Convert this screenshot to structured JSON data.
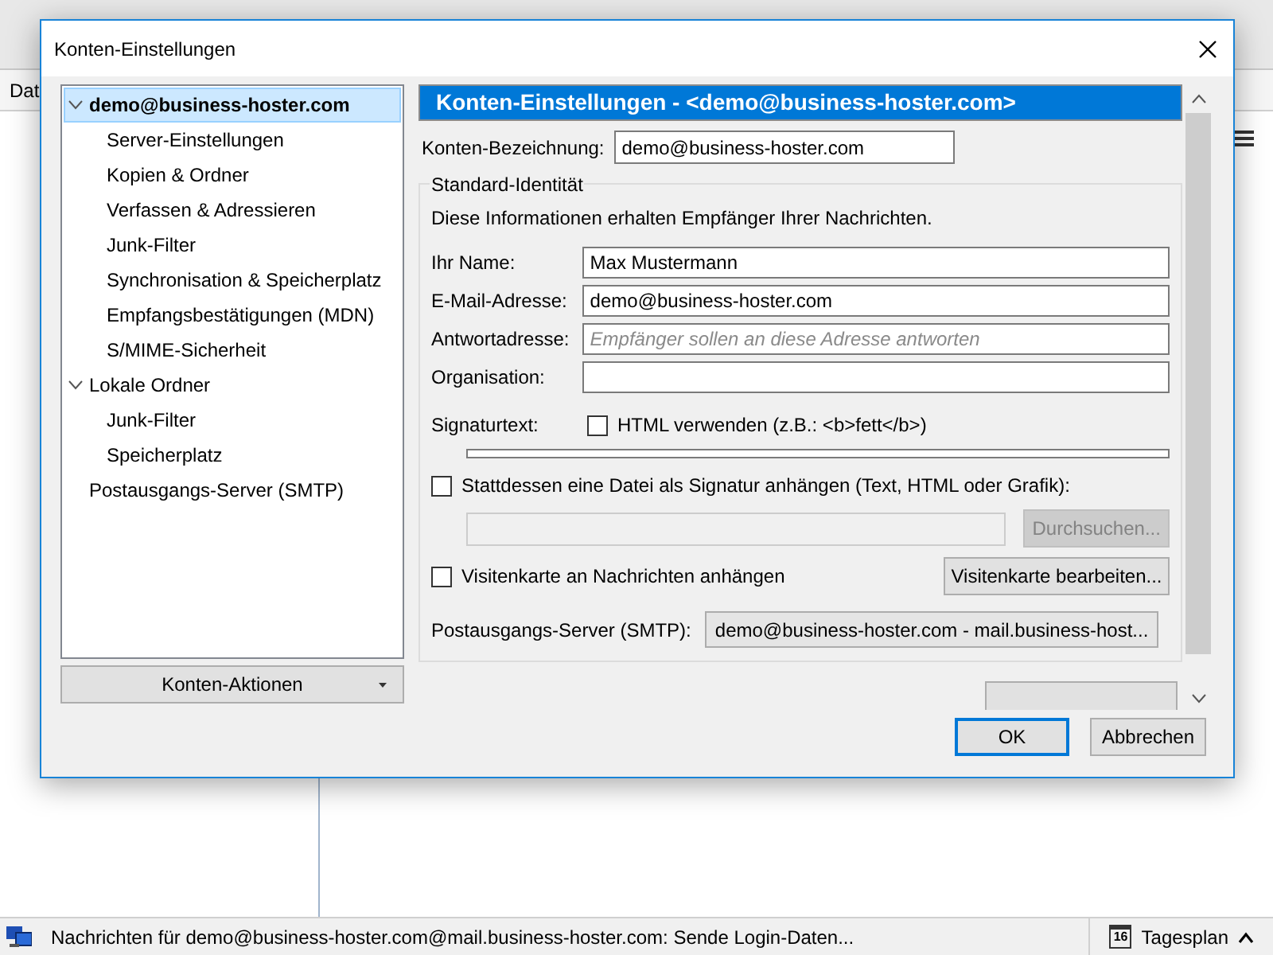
{
  "background_window": {
    "menu_label": "Dat",
    "status_bar": {
      "text": "Nachrichten für demo@business-hoster.com@mail.business-hoster.com: Sende Login-Daten...",
      "calendar_day": "16",
      "calendar_label": "Tagesplan"
    }
  },
  "dialog": {
    "title": "Konten-Einstellungen",
    "tree": [
      {
        "label": "demo@business-hoster.com",
        "bold": true,
        "expanded": true,
        "selected": true,
        "children": [
          {
            "label": "Server-Einstellungen",
            "selected": false
          },
          {
            "label": "Kopien & Ordner",
            "selected": false
          },
          {
            "label": "Verfassen & Adressieren",
            "selected": false
          },
          {
            "label": "Junk-Filter",
            "selected": false
          },
          {
            "label": "Synchronisation & Speicherplatz",
            "selected": false
          },
          {
            "label": "Empfangsbestätigungen (MDN)",
            "selected": false
          },
          {
            "label": "S/MIME-Sicherheit",
            "selected": false
          }
        ]
      },
      {
        "label": "Lokale Ordner",
        "bold": false,
        "expanded": true,
        "selected": false,
        "children": [
          {
            "label": "Junk-Filter",
            "selected": false
          },
          {
            "label": "Speicherplatz",
            "selected": false
          }
        ]
      },
      {
        "label": "Postausgangs-Server (SMTP)",
        "bold": false,
        "selected": false
      }
    ],
    "actions_button": "Konten-Aktionen",
    "header": "Konten-Einstellungen - <demo@business-hoster.com>",
    "account_name": {
      "label": "Konten-Bezeichnung:",
      "value": "demo@business-hoster.com"
    },
    "identity": {
      "legend": "Standard-Identität",
      "description": "Diese Informationen erhalten Empfänger Ihrer Nachrichten.",
      "fields": [
        {
          "label": "Ihr Name:",
          "value": "Max Mustermann"
        },
        {
          "label": "E-Mail-Adresse:",
          "value": "demo@business-hoster.com"
        },
        {
          "label": "Antwortadresse:",
          "placeholder": "Empfänger sollen an diese Adresse antworten"
        },
        {
          "label": "Organisation:"
        }
      ],
      "signature_label": "Signaturtext:",
      "html_checkbox": {
        "label": "HTML verwenden (z.B.: <b>fett</b>)",
        "checked": false
      },
      "file_checkbox": {
        "label": "Stattdessen eine Datei als Signatur anhängen (Text, HTML oder Grafik):",
        "checked": false
      },
      "browse_button": {
        "label": "Durchsuchen...",
        "disabled": true
      },
      "vcard_checkbox": {
        "label": "Visitenkarte an Nachrichten anhängen",
        "checked": false
      },
      "vcard_button": "Visitenkarte bearbeiten...",
      "smtp": {
        "label": "Postausgangs-Server (SMTP):",
        "value": "demo@business-hoster.com - mail.business-host..."
      }
    },
    "buttons": [
      {
        "label": "OK",
        "default": true
      },
      {
        "label": "Abbrechen",
        "default": false
      }
    ]
  }
}
